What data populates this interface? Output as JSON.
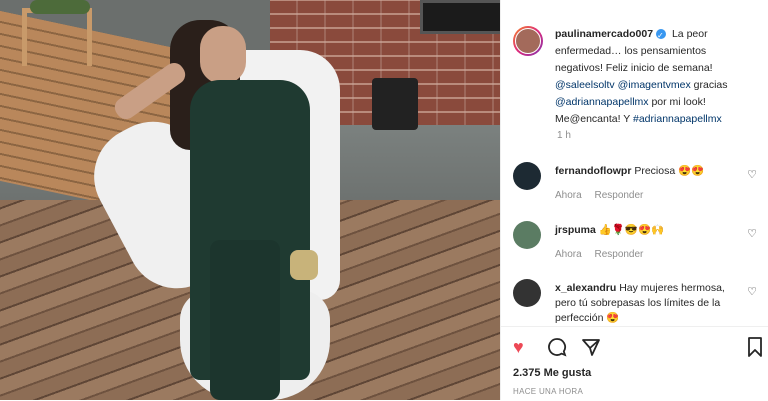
{
  "post": {
    "author": "paulinamercado007",
    "caption_text": "La peor enfermedad… los pensamientos negativos! Feliz inicio de semana!",
    "mention_1": "@saleelsoltv",
    "mention_2": "@imagentvmex",
    "word_gracias": "gracias",
    "mention_3": "@adriannapapellmx",
    "tail_1": "por mi look! Me@encanta! Y",
    "hashtag": "#adriannapapellmx",
    "time_ago": "1 h"
  },
  "comments": [
    {
      "user": "fernandoflowpr",
      "text": "Preciosa 😍😍",
      "when": "Ahora",
      "reply": "Responder",
      "avatar_color": "#1d2a33"
    },
    {
      "user": "jrspuma",
      "text": "👍🌹😎😍🙌",
      "when": "Ahora",
      "reply": "Responder",
      "avatar_color": "#5b7c63"
    },
    {
      "user": "x_alexandru",
      "text": "Hay mujeres hermosa, pero tú sobrepasas los límites de la perfección 😍",
      "avatar_color": "#333333"
    }
  ],
  "actions": {
    "likes": "2.375 Me gusta",
    "posted": "HACE UNA HORA"
  },
  "icons": {
    "like": "heart-icon",
    "comment": "comment-icon",
    "share": "share-icon",
    "save": "bookmark-icon"
  },
  "colors": {
    "like": "#ed4956",
    "link": "#003569",
    "verified": "#3897f0"
  }
}
